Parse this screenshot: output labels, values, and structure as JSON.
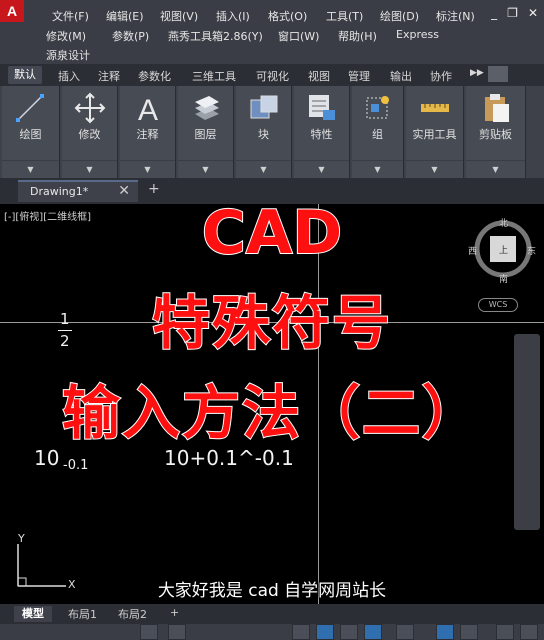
{
  "app": {
    "logo_letter": "A"
  },
  "menu": {
    "row1": [
      "文件(F)",
      "编辑(E)",
      "视图(V)",
      "插入(I)",
      "格式(O)",
      "工具(T)",
      "绘图(D)",
      "标注(N)"
    ],
    "row2": [
      "修改(M)",
      "参数(P)",
      "燕秀工具箱2.86(Y)",
      "窗口(W)",
      "帮助(H)",
      "Express"
    ],
    "row3": [
      "源泉设计"
    ]
  },
  "ribbon_tabs": [
    "默认",
    "插入",
    "注释",
    "参数化",
    "三维工具",
    "可视化",
    "视图",
    "管理",
    "输出",
    "协作"
  ],
  "ribbon_panels": [
    {
      "label": "绘图",
      "icon": "line-draw-icon"
    },
    {
      "label": "修改",
      "icon": "move-arrows-icon"
    },
    {
      "label": "注释",
      "icon": "text-a-icon"
    },
    {
      "label": "图层",
      "icon": "layers-icon"
    },
    {
      "label": "块",
      "icon": "block-icon"
    },
    {
      "label": "特性",
      "icon": "properties-icon"
    },
    {
      "label": "组",
      "icon": "group-icon"
    },
    {
      "label": "实用工具",
      "icon": "measure-ruler-icon"
    },
    {
      "label": "剪贴板",
      "icon": "clipboard-icon"
    }
  ],
  "file_tab": {
    "label": "Drawing1*",
    "close": "✕",
    "new": "+"
  },
  "canvas": {
    "viewport_label": "[-][俯视][二维线框]",
    "overlay": {
      "line1": "CAD",
      "line2": "特殊符号",
      "line3": "输入方法（二）"
    },
    "fraction": {
      "numerator": "1",
      "denominator": "2"
    },
    "tolerance_base": "10",
    "tolerance_sub": "-0.1",
    "tolerance_expr": "10+0.1^-0.1",
    "viewcube": {
      "north": "北",
      "south": "南",
      "east": "东",
      "west": "西",
      "top": "上"
    },
    "wcs": "WCS",
    "ucs_y": "Y",
    "ucs_x": "X",
    "subtitle": "大家好我是 cad 自学网周站长"
  },
  "layout_tabs": [
    "模型",
    "布局1",
    "布局2",
    "+"
  ]
}
